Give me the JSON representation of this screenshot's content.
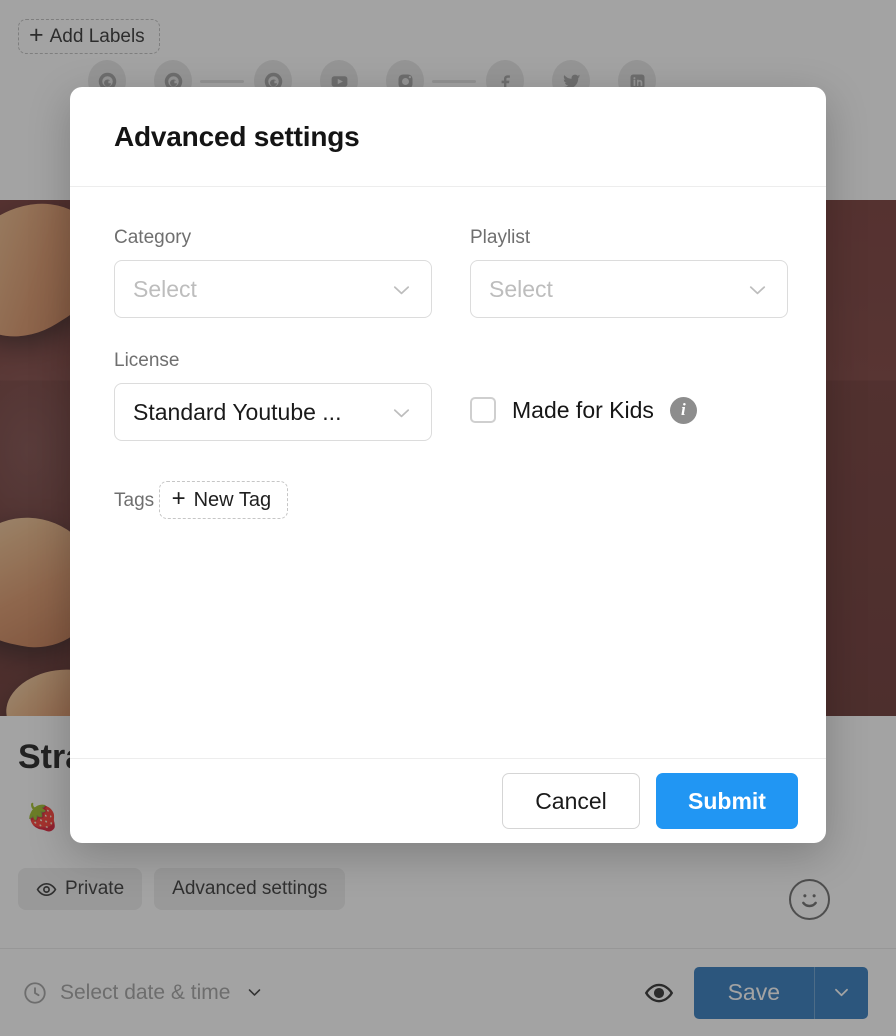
{
  "background": {
    "add_labels": {
      "label": "Add Labels",
      "icon": "plus-icon"
    },
    "social_icons": [
      {
        "name": "google-icon",
        "glyph": "G"
      },
      {
        "name": "google-icon",
        "glyph": "G"
      },
      {
        "name": "google-icon",
        "glyph": "G"
      },
      {
        "name": "youtube-icon",
        "glyph": "▶"
      },
      {
        "name": "instagram-icon",
        "glyph": "▣"
      },
      {
        "name": "facebook-icon",
        "glyph": "f"
      },
      {
        "name": "twitter-icon",
        "glyph": "✉"
      },
      {
        "name": "linkedin-icon",
        "glyph": "in"
      }
    ],
    "post": {
      "title": "Stra",
      "emoji": "🍓",
      "privacy_label": "Private",
      "advanced_label": "Advanced settings"
    },
    "bottom_bar": {
      "schedule_placeholder": "Select date & time",
      "save_label": "Save"
    },
    "image_color": "#6a2b28"
  },
  "modal": {
    "title": "Advanced settings",
    "fields": {
      "category": {
        "label": "Category",
        "value": "",
        "placeholder": "Select"
      },
      "playlist": {
        "label": "Playlist",
        "value": "",
        "placeholder": "Select"
      },
      "license": {
        "label": "License",
        "value": "Standard Youtube ...",
        "placeholder": "Select"
      }
    },
    "made_for_kids": {
      "label": "Made for Kids",
      "checked": false,
      "info_glyph": "i"
    },
    "tags": {
      "label": "Tags",
      "new_tag_label": "New Tag"
    },
    "footer": {
      "cancel_label": "Cancel",
      "submit_label": "Submit"
    },
    "accent_color": "#2196f3"
  }
}
